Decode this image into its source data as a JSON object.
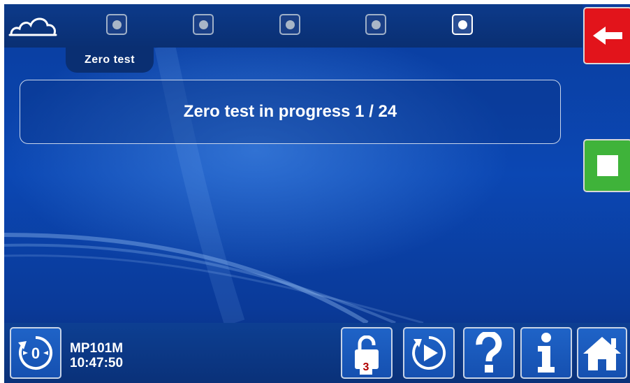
{
  "header": {
    "logo_icon": "cloud-logo-icon",
    "steps": [
      {
        "state": "inactive"
      },
      {
        "state": "inactive"
      },
      {
        "state": "inactive"
      },
      {
        "state": "inactive"
      },
      {
        "state": "active"
      }
    ]
  },
  "page": {
    "title": "Zero test",
    "status_message": "Zero test in progress 1 / 24"
  },
  "side_buttons": {
    "back_icon": "arrow-left-icon",
    "stop_icon": "stop-icon"
  },
  "footer": {
    "device_name": "MP101M",
    "time": "10:47:50",
    "zero_icon": "zero-cycle-icon",
    "lock_level": "3",
    "buttons": [
      "unlock-icon",
      "play-icon",
      "question-icon",
      "info-icon",
      "home-icon"
    ]
  },
  "colors": {
    "background": "#0b47b3",
    "back_button": "#e2141b",
    "stop_button": "#3fb33a",
    "footer_button": "#1f63c7"
  }
}
